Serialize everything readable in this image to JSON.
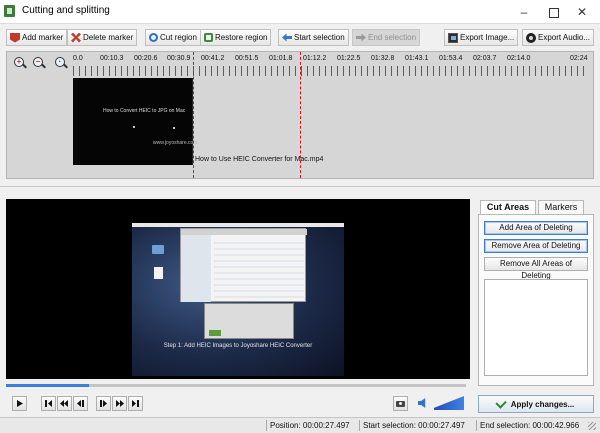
{
  "window": {
    "title": "Cutting and splitting",
    "minimize_glyph": "–",
    "close_glyph": "✕"
  },
  "toolbar": {
    "add_marker": "Add marker",
    "delete_marker": "Delete marker",
    "cut_region": "Cut region",
    "restore_region": "Restore region",
    "start_selection": "Start selection",
    "end_selection": "End selection",
    "export_image": "Export Image...",
    "export_audio": "Export Audio..."
  },
  "zoom": {
    "zoom_in_sign": "+",
    "zoom_out_sign": "−",
    "zoom_fit_sign": "·"
  },
  "timeline": {
    "ruler_labels": [
      "0.0",
      "00:10.3",
      "00:20.6",
      "00:30.9",
      "00:41.2",
      "00:51.5",
      "01:01.8",
      "01:12.2",
      "01:22.5",
      "01:32.8",
      "01:43.1",
      "01:53.4",
      "02:03.7",
      "02:14.0",
      "02:24"
    ],
    "track_label": "How to Use HEIC Converter for Mac.mp4",
    "thumb_title": "How to Convert HEIC to JPG on Mac",
    "thumb_url": "www.joyoshare.com"
  },
  "preview": {
    "caption": "Step 1: Add HEIC Images to Joyoshare HEIC Converter",
    "progress_fraction": 0.18
  },
  "side_panel": {
    "tab_cut_areas": "Cut Areas",
    "tab_markers": "Markers",
    "add_area": "Add Area of Deleting",
    "remove_area": "Remove Area of Deleting",
    "remove_all": "Remove All Areas of Deleting",
    "apply": "Apply changes..."
  },
  "status": {
    "position": "Position: 00:00:27.497",
    "start_selection": "Start selection: 00:00:27.497",
    "end_selection": "End selection: 00:00:42.966"
  },
  "colors": {
    "selection_marker": "#d01818",
    "progress_fill": "#3b7fd8",
    "accent_blue": "#3d7bd6"
  }
}
